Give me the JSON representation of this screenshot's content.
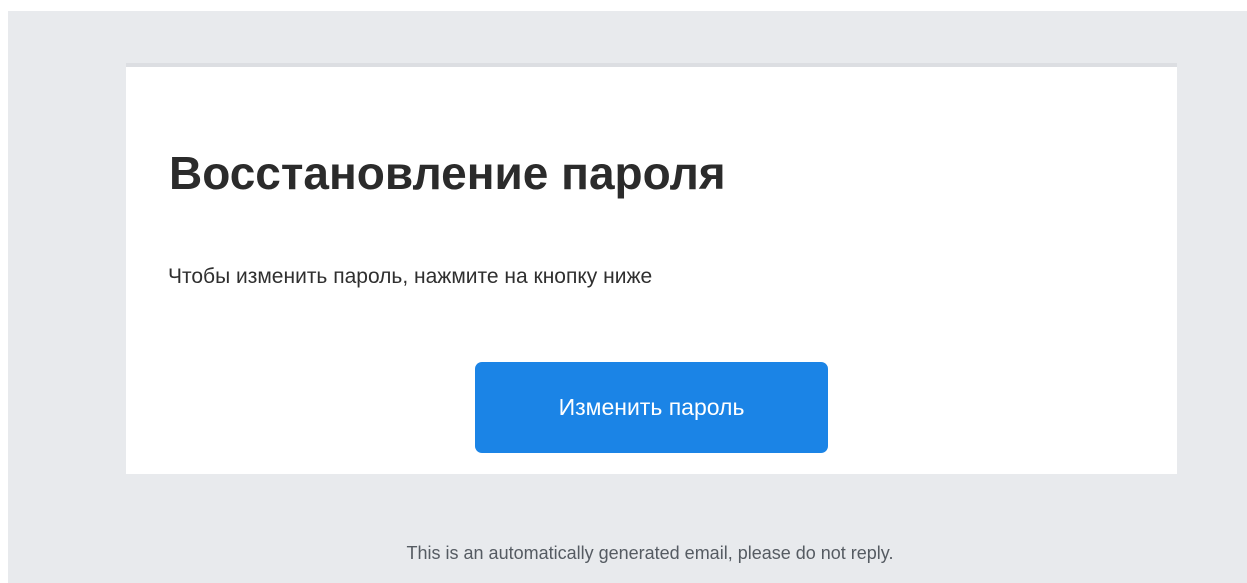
{
  "email": {
    "title": "Восстановление пароля",
    "body_text": "Чтобы изменить пароль, нажмите на кнопку ниже",
    "button_label": "Изменить пароль",
    "footer_note": "This is an automatically generated email, please do not reply."
  },
  "colors": {
    "background": "#e8eaed",
    "card": "#ffffff",
    "button": "#1b84e6",
    "title_text": "#2b2b2b",
    "footer_text": "#555b62"
  }
}
